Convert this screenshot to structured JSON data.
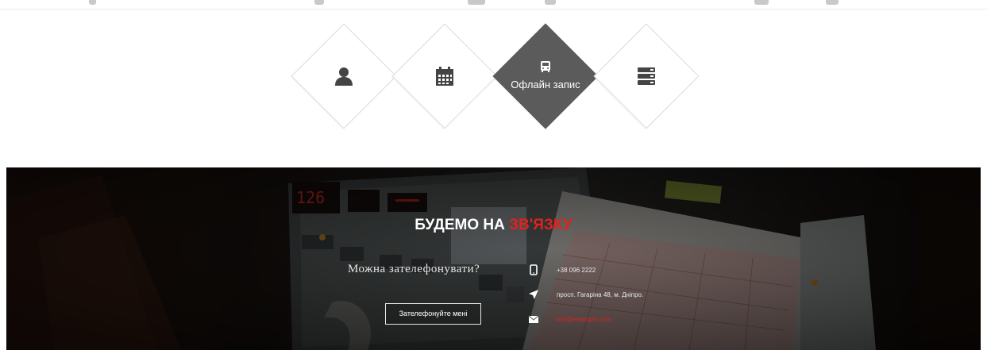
{
  "steps": [
    {
      "name": "user",
      "icon": "user-icon",
      "label": ""
    },
    {
      "name": "calendar",
      "icon": "calendar-icon",
      "label": ""
    },
    {
      "name": "offline",
      "icon": "bus-icon",
      "label": "Офлайн запис",
      "active": true
    },
    {
      "name": "list",
      "icon": "server-list-icon",
      "label": ""
    }
  ],
  "contact": {
    "title_main": "БУДЕМО НА ",
    "title_accent": "ЗВ'ЯЗКУ",
    "question": "Можна зателефонувати?",
    "button_label": "Зателефонуйте мені",
    "phone": "+38 096 2222",
    "address": "просп. Гагаріна 48, м. Дніпро.",
    "email": "info@example.com"
  },
  "colors": {
    "accent": "#e2211c",
    "active_step": "#5b5b5b",
    "icon": "#444444"
  }
}
